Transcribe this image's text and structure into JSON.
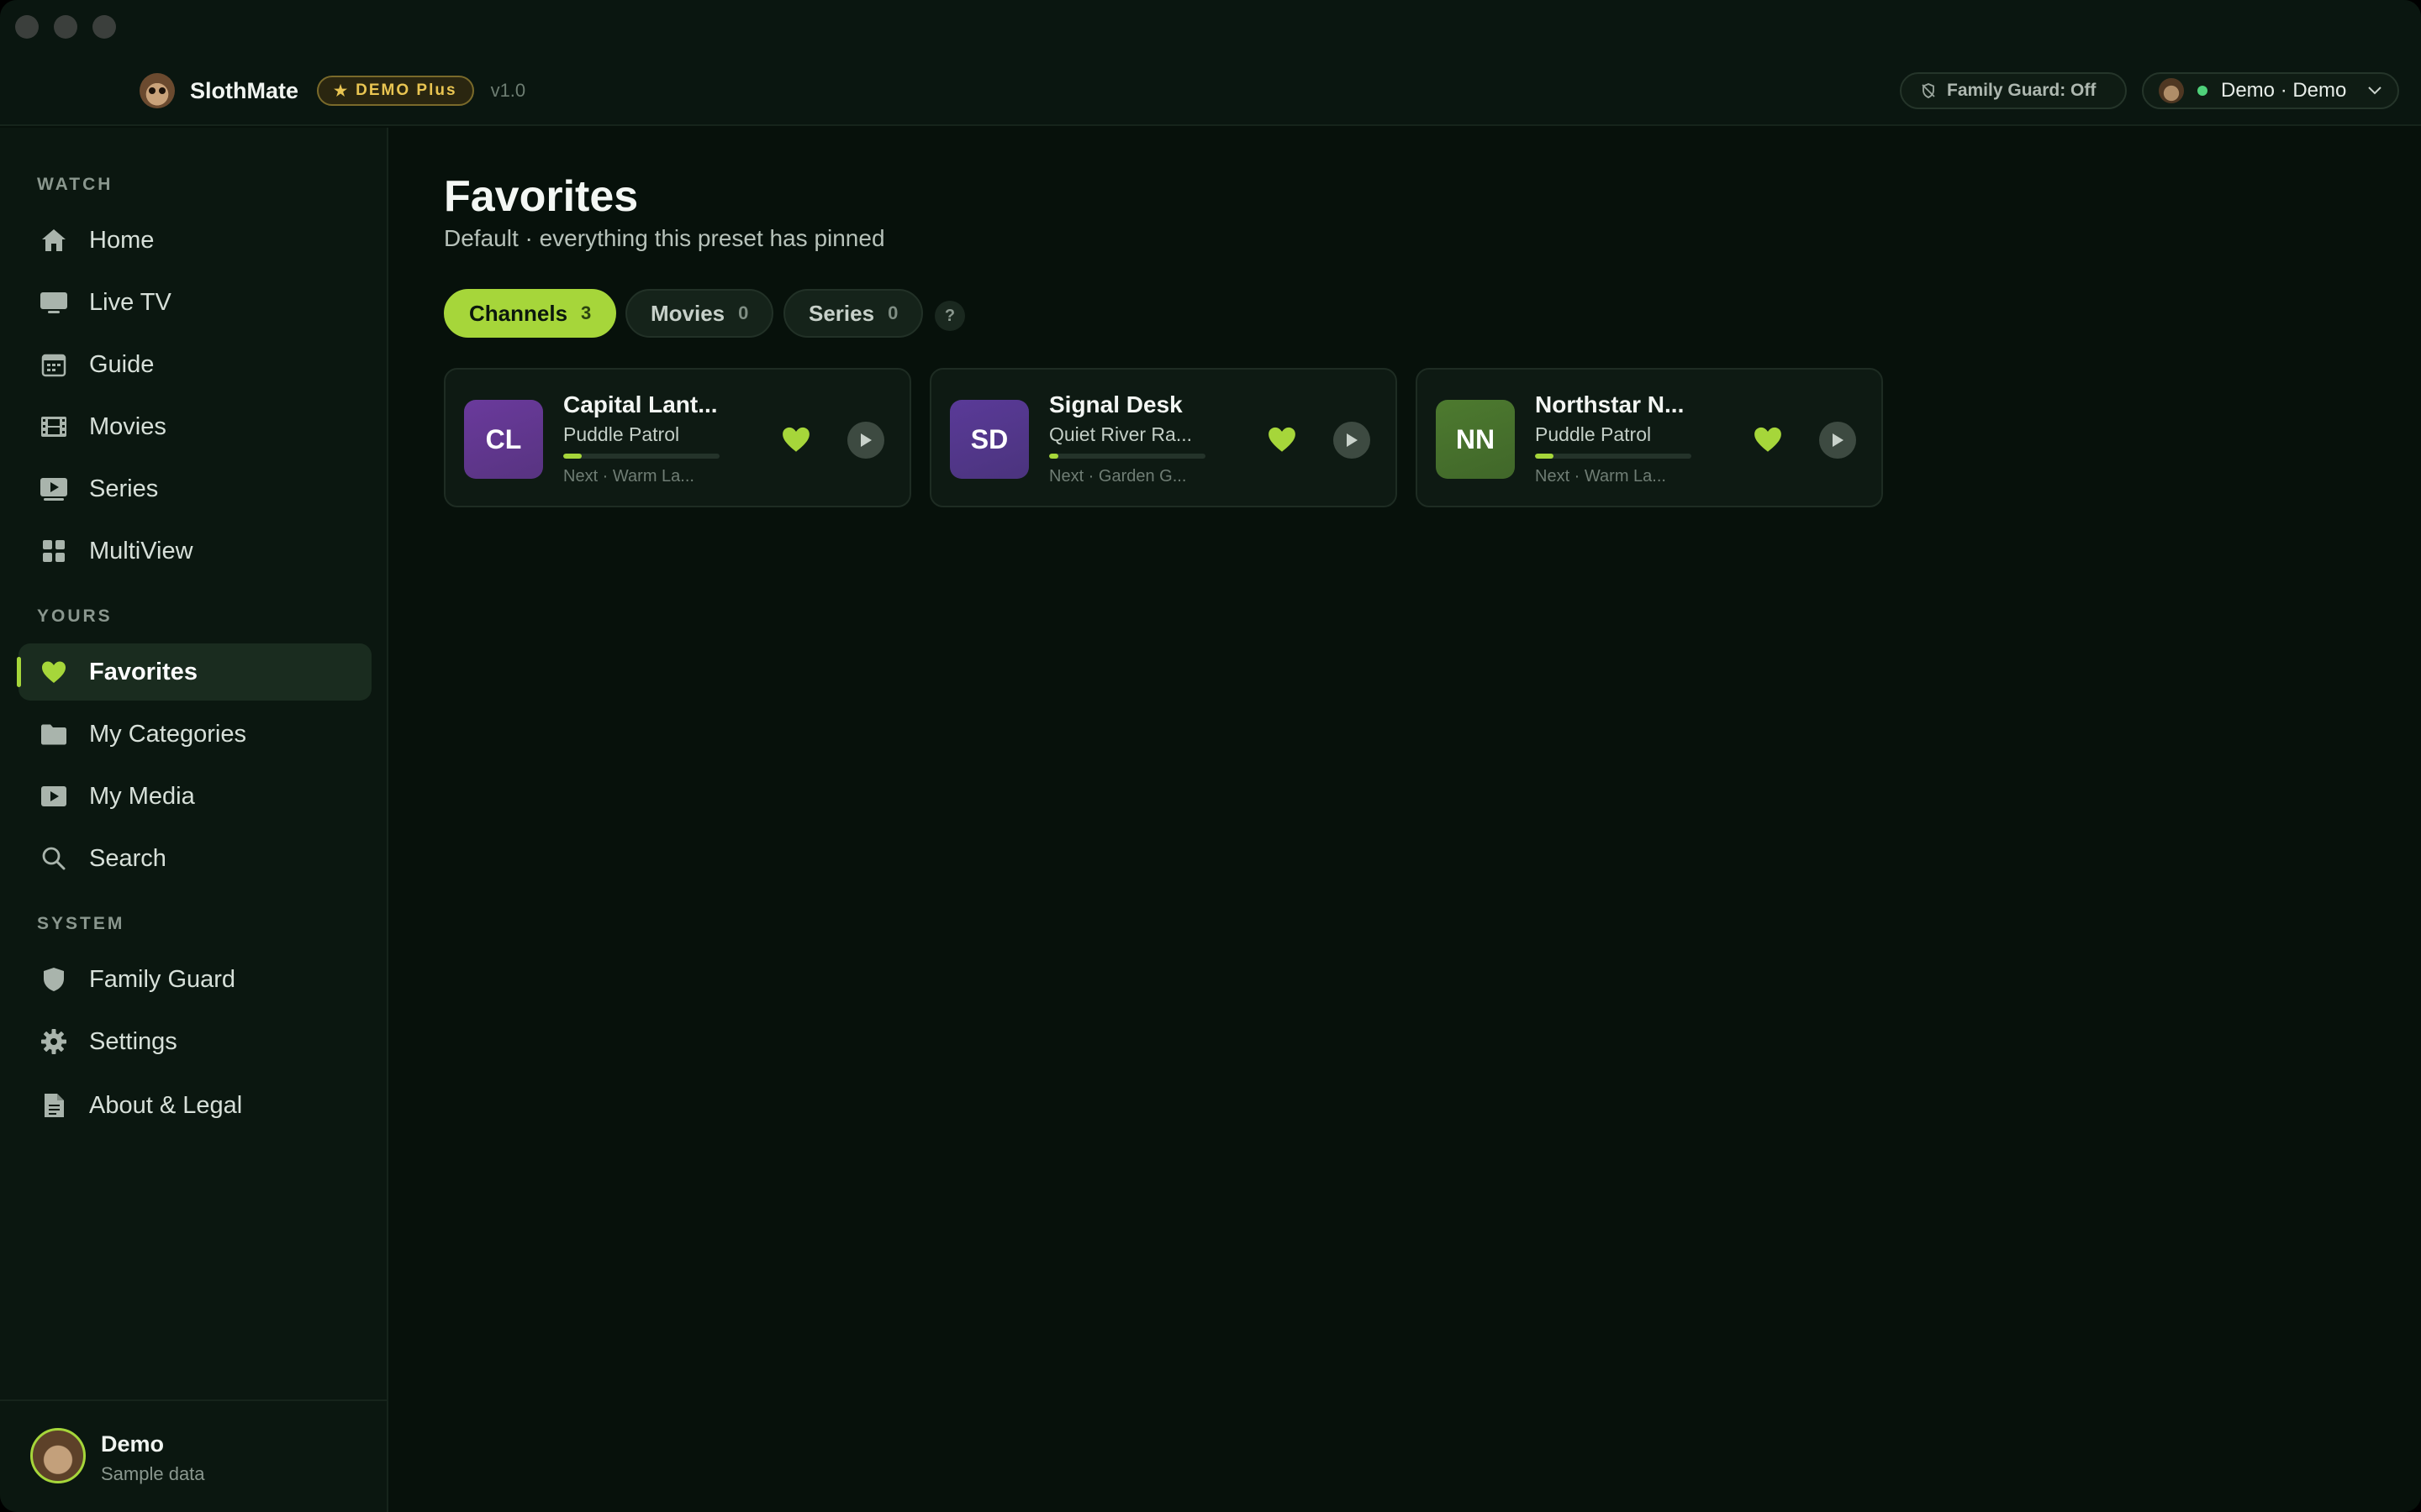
{
  "app": {
    "name": "SlothMate",
    "badge": "DEMO Plus",
    "version": "v1.0",
    "family_guard_status": "Family Guard: Off",
    "profile": "Demo · Demo",
    "accent_color": "#a6d63a"
  },
  "sidebar": {
    "sections": {
      "watch": "WATCH",
      "yours": "YOURS",
      "system": "SYSTEM"
    },
    "items": [
      {
        "label": "Home",
        "icon": "home-icon"
      },
      {
        "label": "Live TV",
        "icon": "tv-icon"
      },
      {
        "label": "Guide",
        "icon": "calendar-icon"
      },
      {
        "label": "Movies",
        "icon": "film-icon"
      },
      {
        "label": "Series",
        "icon": "series-icon"
      },
      {
        "label": "MultiView",
        "icon": "grid-icon"
      },
      {
        "label": "Favorites",
        "icon": "heart-icon",
        "active": true
      },
      {
        "label": "My Categories",
        "icon": "folder-icon"
      },
      {
        "label": "My Media",
        "icon": "play-square-icon"
      },
      {
        "label": "Search",
        "icon": "search-icon"
      },
      {
        "label": "Family Guard",
        "icon": "shield-icon"
      },
      {
        "label": "Settings",
        "icon": "gear-icon"
      },
      {
        "label": "About & Legal",
        "icon": "document-icon"
      }
    ],
    "user": {
      "name": "Demo",
      "subtitle": "Sample data"
    }
  },
  "main": {
    "title": "Favorites",
    "subtitle": "Default · everything this preset has pinned",
    "tabs": [
      {
        "label": "Channels",
        "count": "3",
        "active": true
      },
      {
        "label": "Movies",
        "count": "0"
      },
      {
        "label": "Series",
        "count": "0"
      }
    ],
    "help": "?",
    "channels": [
      {
        "initials": "CL",
        "name": "Capital Lant...",
        "program": "Puddle Patrol",
        "next": "Next · Warm La...",
        "progress": 0.12,
        "color": "#6a3a9c"
      },
      {
        "initials": "SD",
        "name": "Signal Desk",
        "program": "Quiet River Ra...",
        "next": "Next · Garden G...",
        "progress": 0.06,
        "color": "#5a3a98"
      },
      {
        "initials": "NN",
        "name": "Northstar N...",
        "program": "Puddle Patrol",
        "next": "Next · Warm La...",
        "progress": 0.12,
        "color": "#4d7a2f"
      }
    ]
  }
}
